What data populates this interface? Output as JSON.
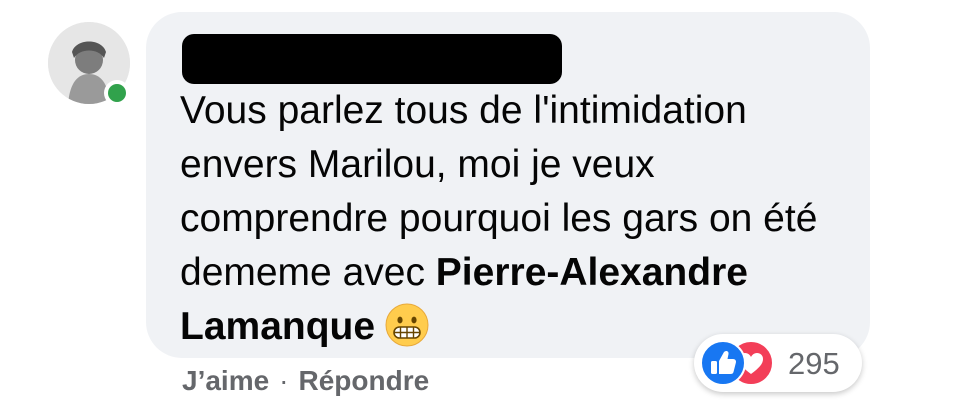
{
  "comment": {
    "author_name_redacted": true,
    "text_before_mention": "Vous parlez tous de l'intimidation envers Marilou, moi je veux comprendre pourquoi les gars on été dememe avec ",
    "mention": "Pierre-Alexandre Lamanque",
    "emoji": "grimacing-face"
  },
  "actions": {
    "like_label": "J’aime",
    "separator": "·",
    "reply_label": "Répondre"
  },
  "reactions": {
    "icons": [
      "like-icon",
      "love-icon"
    ],
    "count": "295"
  },
  "colors": {
    "bubble": "#f0f2f5",
    "online": "#31a24c",
    "like": "#1877f2",
    "love": "#f33e58",
    "meta_text": "#65676b"
  }
}
